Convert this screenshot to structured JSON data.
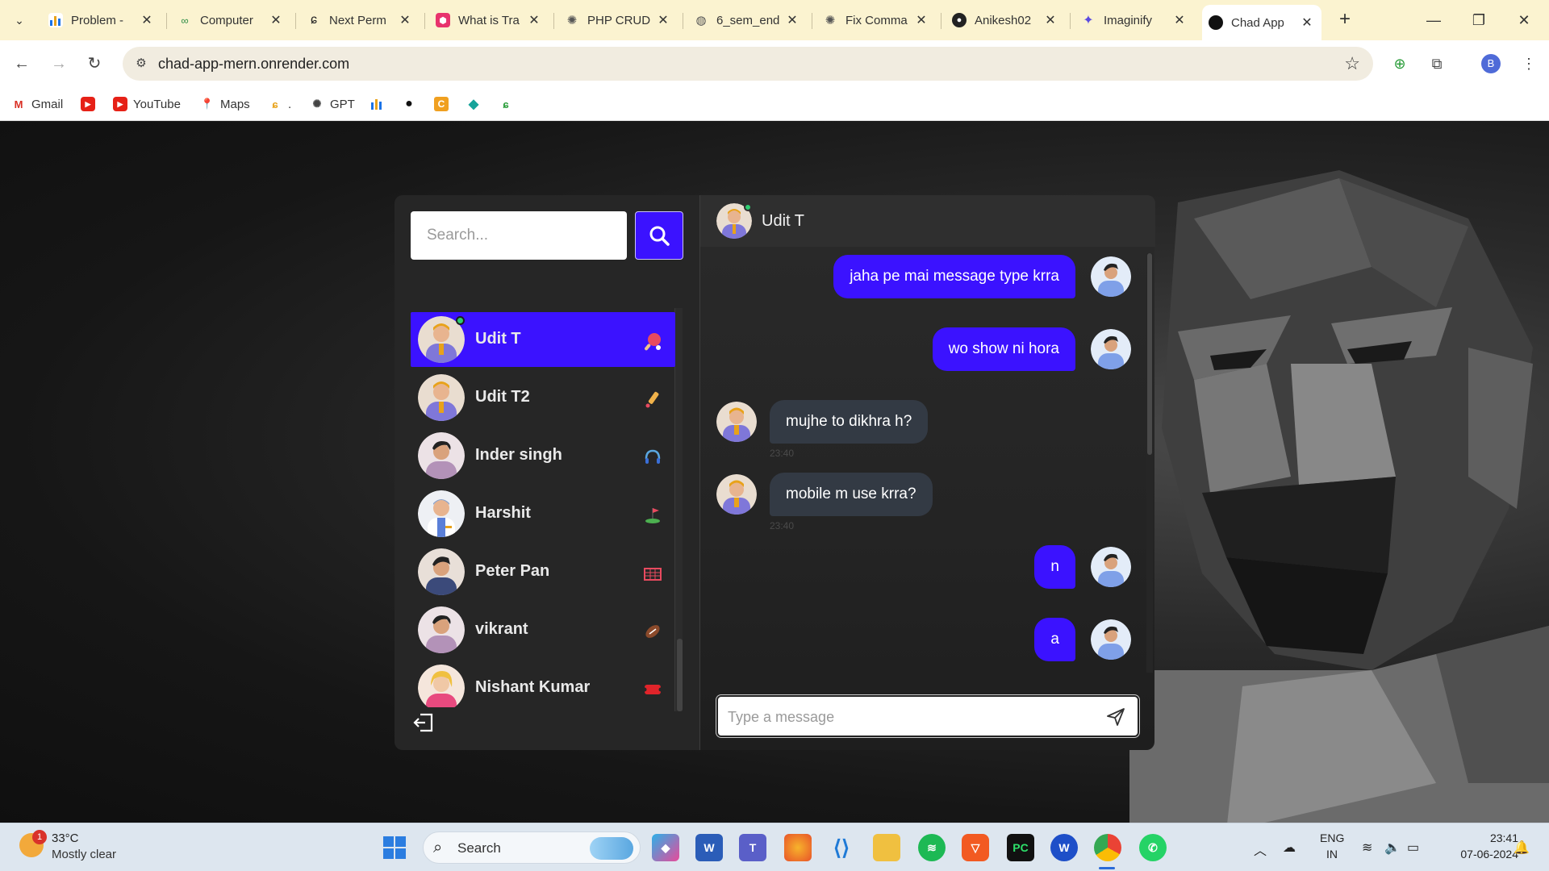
{
  "browser": {
    "tabs": [
      {
        "title": "Problem -",
        "color": "#1a73e8"
      },
      {
        "title": "Computer",
        "color": "#2f8d46"
      },
      {
        "title": "Next Perm",
        "color": "#222222"
      },
      {
        "title": "What is Tra",
        "color": "#e8336d"
      },
      {
        "title": "PHP CRUD",
        "color": "#555555"
      },
      {
        "title": "6_sem_end",
        "color": "#555555"
      },
      {
        "title": "Fix Comma",
        "color": "#555555"
      },
      {
        "title": "Anikesh02",
        "color": "#222222"
      },
      {
        "title": "Imaginify",
        "color": "#5b4be0"
      },
      {
        "title": "Chad App",
        "color": "#111111"
      }
    ],
    "new_tab": "+",
    "url": "chad-app-mern.onrender.com",
    "profile_initial": "B",
    "bookmarks": [
      {
        "label": "Gmail"
      },
      {
        "label": ""
      },
      {
        "label": "YouTube"
      },
      {
        "label": "Maps"
      },
      {
        "label": "."
      },
      {
        "label": "GPT"
      }
    ]
  },
  "app": {
    "search": {
      "placeholder": "Search..."
    },
    "contacts": [
      {
        "name": "Udit T",
        "active": true,
        "online": true,
        "sport_icon": "ping-pong-icon"
      },
      {
        "name": "Udit T2",
        "active": false,
        "online": false,
        "sport_icon": "cricket-bat-icon"
      },
      {
        "name": "Inder singh",
        "active": false,
        "online": false,
        "sport_icon": "headset-icon"
      },
      {
        "name": "Harshit",
        "active": false,
        "online": false,
        "sport_icon": "golf-icon"
      },
      {
        "name": "Peter Pan",
        "active": false,
        "online": false,
        "sport_icon": "goal-net-icon"
      },
      {
        "name": "vikrant",
        "active": false,
        "online": false,
        "sport_icon": "rugby-ball-icon"
      },
      {
        "name": "Nishant Kumar",
        "active": false,
        "online": false,
        "sport_icon": "ticket-icon"
      }
    ],
    "chat": {
      "recipient": "Udit T",
      "messages": [
        {
          "text": "jaha pe mai message type krra",
          "direction": "sent",
          "time": ""
        },
        {
          "text": "wo show ni hora",
          "direction": "sent",
          "time": ""
        },
        {
          "text": "mujhe to dikhra h?",
          "direction": "received",
          "time": "23:40"
        },
        {
          "text": "mobile m use krra?",
          "direction": "received",
          "time": "23:40"
        },
        {
          "text": "n",
          "direction": "sent",
          "time": ""
        },
        {
          "text": "a",
          "direction": "sent",
          "time": ""
        }
      ],
      "composer_placeholder": "Type a message"
    }
  },
  "taskbar": {
    "weather_badge": "1",
    "temperature": "33°C",
    "weather": "Mostly clear",
    "search_label": "Search",
    "lang_top": "ENG",
    "lang_bottom": "IN",
    "time": "23:41",
    "date": "07-06-2024"
  },
  "colors": {
    "accent": "#3b12ff",
    "online": "#2ecc71",
    "received_bubble": "#333a44"
  }
}
